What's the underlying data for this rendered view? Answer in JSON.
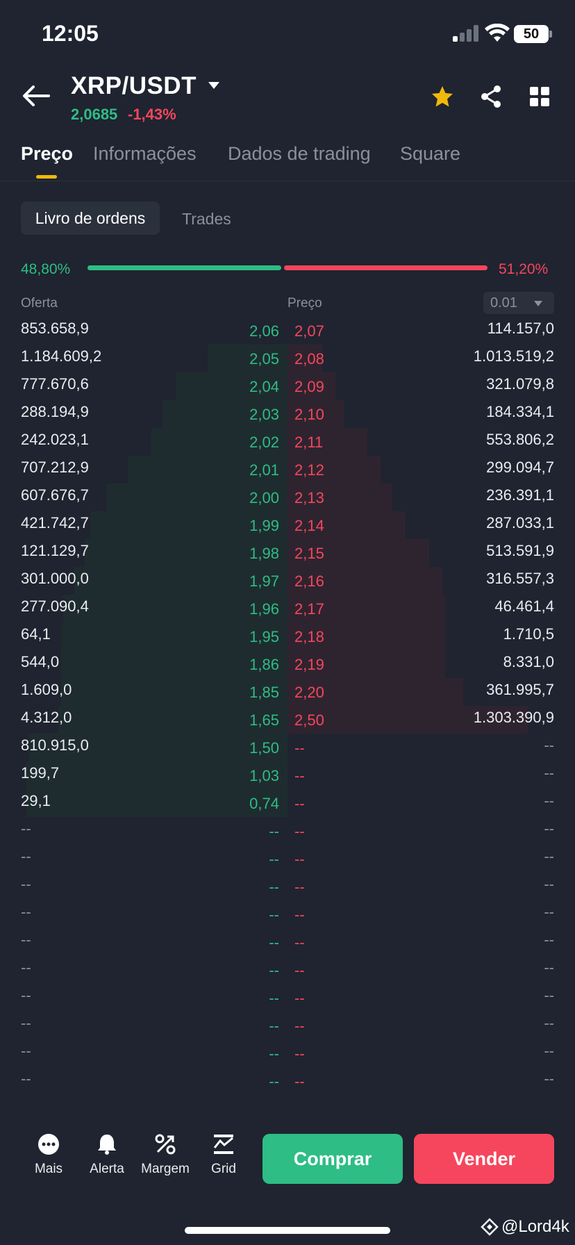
{
  "status_bar": {
    "time": "12:05",
    "battery": "50"
  },
  "header": {
    "pair": "XRP/USDT",
    "last_price": "2,0685",
    "change": "-1,43%"
  },
  "tabs": [
    {
      "label": "Preço",
      "active": true
    },
    {
      "label": "Informações",
      "active": false
    },
    {
      "label": "Dados de trading",
      "active": false
    },
    {
      "label": "Square",
      "active": false
    }
  ],
  "segments": {
    "active": "Livro de ordens",
    "inactive": "Trades"
  },
  "ratio": {
    "bid_pct": "48,80%",
    "ask_pct": "51,20%",
    "bid_fraction": 0.488
  },
  "columns": {
    "bid": "Oferta",
    "price": "Preço",
    "precision": "0.01"
  },
  "order_book": {
    "bids": [
      {
        "qty": "853.658,9",
        "price": "2,06",
        "depth": 0.0
      },
      {
        "qty": "1.184.609,2",
        "price": "2,05",
        "depth": 0.3
      },
      {
        "qty": "777.670,6",
        "price": "2,04",
        "depth": 0.42
      },
      {
        "qty": "288.194,9",
        "price": "2,03",
        "depth": 0.47
      },
      {
        "qty": "242.023,1",
        "price": "2,02",
        "depth": 0.51
      },
      {
        "qty": "707.212,9",
        "price": "2,01",
        "depth": 0.6
      },
      {
        "qty": "607.676,7",
        "price": "2,00",
        "depth": 0.68
      },
      {
        "qty": "421.742,7",
        "price": "1,99",
        "depth": 0.74
      },
      {
        "qty": "121.129,7",
        "price": "1,98",
        "depth": 0.76
      },
      {
        "qty": "301.000,0",
        "price": "1,97",
        "depth": 0.8
      },
      {
        "qty": "277.090,4",
        "price": "1,96",
        "depth": 0.84
      },
      {
        "qty": "64,1",
        "price": "1,95",
        "depth": 0.85
      },
      {
        "qty": "544,0",
        "price": "1,86",
        "depth": 0.85
      },
      {
        "qty": "1.609,0",
        "price": "1,85",
        "depth": 0.85
      },
      {
        "qty": "4.312,0",
        "price": "1,65",
        "depth": 0.86
      },
      {
        "qty": "810.915,0",
        "price": "1,50",
        "depth": 0.97
      },
      {
        "qty": "199,7",
        "price": "1,03",
        "depth": 0.98
      },
      {
        "qty": "29,1",
        "price": "0,74",
        "depth": 0.98
      }
    ],
    "asks": [
      {
        "price": "2,07",
        "qty": "114.157,0",
        "depth": 0.0
      },
      {
        "price": "2,08",
        "qty": "1.013.519,2",
        "depth": 0.13
      },
      {
        "price": "2,09",
        "qty": "321.079,8",
        "depth": 0.18
      },
      {
        "price": "2,10",
        "qty": "184.334,1",
        "depth": 0.21
      },
      {
        "price": "2,11",
        "qty": "553.806,2",
        "depth": 0.3
      },
      {
        "price": "2,12",
        "qty": "299.094,7",
        "depth": 0.35
      },
      {
        "price": "2,13",
        "qty": "236.391,1",
        "depth": 0.39
      },
      {
        "price": "2,14",
        "qty": "287.033,1",
        "depth": 0.44
      },
      {
        "price": "2,15",
        "qty": "513.591,9",
        "depth": 0.53
      },
      {
        "price": "2,16",
        "qty": "316.557,3",
        "depth": 0.58
      },
      {
        "price": "2,17",
        "qty": "46.461,4",
        "depth": 0.59
      },
      {
        "price": "2,18",
        "qty": "1.710,5",
        "depth": 0.59
      },
      {
        "price": "2,19",
        "qty": "8.331,0",
        "depth": 0.59
      },
      {
        "price": "2,20",
        "qty": "361.995,7",
        "depth": 0.66
      },
      {
        "price": "2,50",
        "qty": "1.303.390,9",
        "depth": 0.9
      }
    ],
    "placeholder": "--",
    "total_rows": 28
  },
  "bottom_nav": [
    {
      "label": "Mais",
      "icon": "more-icon"
    },
    {
      "label": "Alerta",
      "icon": "bell-icon"
    },
    {
      "label": "Margem",
      "icon": "percent-icon"
    },
    {
      "label": "Grid",
      "icon": "grid-chart-icon"
    }
  ],
  "actions": {
    "buy": "Comprar",
    "sell": "Vender"
  },
  "watermark": "@Lord4k",
  "colors": {
    "green": "#2ebd85",
    "red": "#f6465d",
    "accent": "#f0b90b",
    "background": "#1f2430"
  }
}
